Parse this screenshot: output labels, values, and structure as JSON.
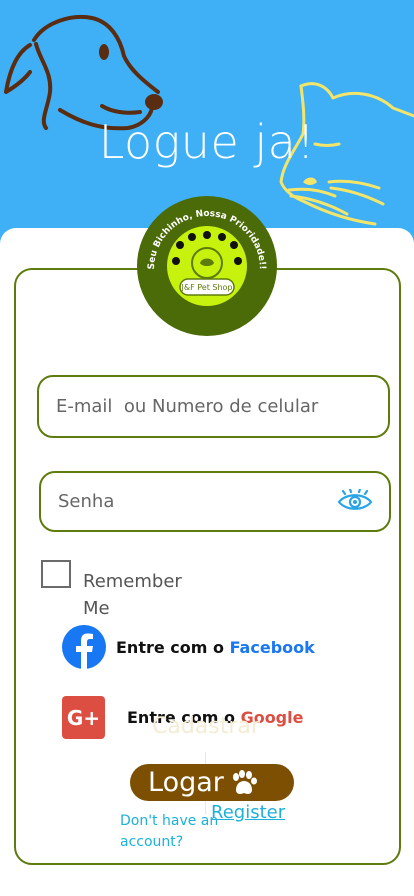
{
  "header": {
    "title": "Logue ja!"
  },
  "logo": {
    "ring_text": "Seu Bichinho, Nossa Prioridade!!",
    "badge_text": "J&F Pet Shop"
  },
  "form": {
    "email_placeholder": "E-mail  ou Numero de celular",
    "password_placeholder": "Senha",
    "remember_label": "Remember Me"
  },
  "social": {
    "facebook_prefix": "Entre com o ",
    "facebook_brand": "Facebook",
    "google_prefix": "Entre com o ",
    "google_brand": "Google",
    "google_icon_text": "G+"
  },
  "ghost_text": "Cadastrar",
  "login_button": "Logar",
  "footer": {
    "no_account": "Don't have an account?",
    "register_link": "Register"
  },
  "colors": {
    "background": "#3fb0f5",
    "accent_green": "#5e7b0d",
    "logo_lime": "#c6f20e",
    "login_brown": "#7c4f03",
    "link_cyan": "#1db0d8",
    "eye_blue": "#2aa4e8"
  },
  "icons": [
    "dog-outline-icon",
    "cat-outline-icon",
    "eye-icon",
    "facebook-icon",
    "google-plus-icon",
    "paw-icon"
  ]
}
